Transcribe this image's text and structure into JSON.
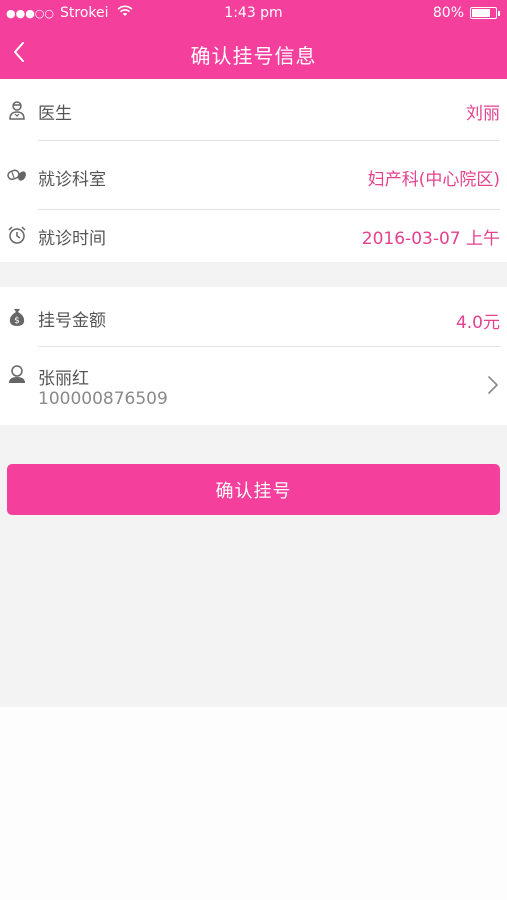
{
  "status_bar": {
    "signal": "●●●○○",
    "carrier": "Strokei",
    "time": "1:43 pm",
    "battery": "80%",
    "battery_level": 0.8
  },
  "nav": {
    "title": "确认挂号信息"
  },
  "appointment": {
    "doctor_label": "医生",
    "doctor_value": "刘丽",
    "department_label": "就诊科室",
    "department_value": "妇产科(中心院区)",
    "time_label": "就诊时间",
    "time_value": "2016-03-07 上午"
  },
  "payment": {
    "fee_label": "挂号金额",
    "fee_value": "4.0元",
    "patient_name": "张丽红",
    "patient_id": "100000876509"
  },
  "actions": {
    "confirm_label": "确认挂号"
  },
  "colors": {
    "accent": "#f53f9c",
    "value_text": "#e4418f",
    "background_gray": "#f3f3f3"
  },
  "icons": {
    "doctor": "doctor-icon",
    "department": "pill-icon",
    "time": "alarm-clock-icon",
    "fee": "money-bag-icon",
    "patient": "user-icon",
    "back": "chevron-left-icon",
    "more": "chevron-right-icon"
  }
}
